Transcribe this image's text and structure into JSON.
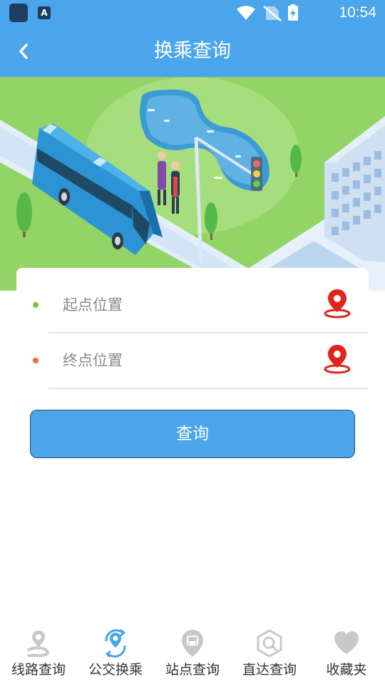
{
  "status_bar": {
    "time": "10:54",
    "app_icon_letter": "A"
  },
  "header": {
    "title": "换乘查询"
  },
  "form": {
    "start_label": "起点位置",
    "end_label": "终点位置",
    "start_dot_color": "#7cc43a",
    "end_dot_color": "#ee6b3b",
    "pin_color": "#e0231b"
  },
  "query_button": {
    "label": "查询"
  },
  "bottom_nav": {
    "items": [
      {
        "label": "线路查询",
        "icon": "route-pin-icon"
      },
      {
        "label": "公交换乘",
        "icon": "transfer-pin-icon",
        "active": true
      },
      {
        "label": "站点查询",
        "icon": "station-pin-icon"
      },
      {
        "label": "直达查询",
        "icon": "search-hexagon-icon"
      },
      {
        "label": "收藏夹",
        "icon": "heart-icon"
      }
    ]
  },
  "colors": {
    "primary": "#4aa5ea",
    "nav_inactive": "#c8c8c8",
    "nav_active": "#4aa5ea"
  }
}
